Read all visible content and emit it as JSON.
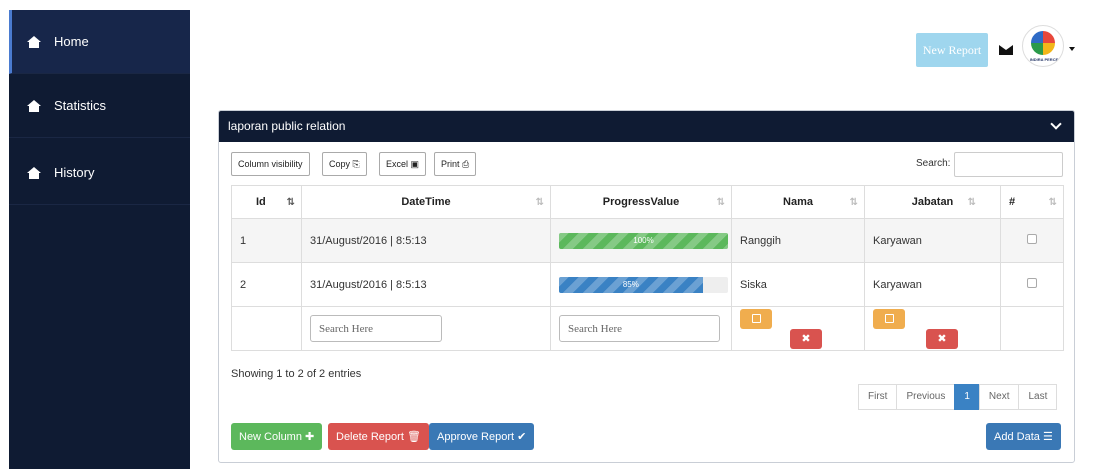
{
  "sidebar": {
    "items": [
      {
        "label": "Home",
        "icon": "home-icon"
      },
      {
        "label": "Statistics",
        "icon": "home-icon"
      },
      {
        "label": "History",
        "icon": "home-icon"
      }
    ]
  },
  "header": {
    "new_report_label": "New Report",
    "mail_icon": "envelope-icon",
    "avatar_logo_text": "INDIRA PERCE"
  },
  "panel": {
    "title": "laporan public relation",
    "toolbar": {
      "column_visibility": "Column visibility",
      "copy": "Copy",
      "excel": "Excel",
      "print": "Print"
    },
    "search_label": "Search:",
    "columns": [
      "Id",
      "DateTime",
      "ProgressValue",
      "Nama",
      "Jabatan",
      "#"
    ],
    "rows": [
      {
        "id": "1",
        "datetime": "31/August/2016 | 8:5:13",
        "progress": 100,
        "progress_label": "100%",
        "progress_color": "#5cb85c",
        "nama": "Ranggih",
        "jabatan": "Karyawan"
      },
      {
        "id": "2",
        "datetime": "31/August/2016 | 8:5:13",
        "progress": 85,
        "progress_label": "85%",
        "progress_color": "#3a82c4",
        "nama": "Siska",
        "jabatan": "Karyawan"
      }
    ],
    "filter_placeholder": "Search Here",
    "info": "Showing 1 to 2 of 2 entries",
    "pagination": [
      "First",
      "Previous",
      "1",
      "Next",
      "Last"
    ],
    "actions": {
      "new_column": "New Column",
      "delete_report": "Delete Report",
      "approve_report": "Approve Report",
      "add_data": "Add Data"
    }
  }
}
